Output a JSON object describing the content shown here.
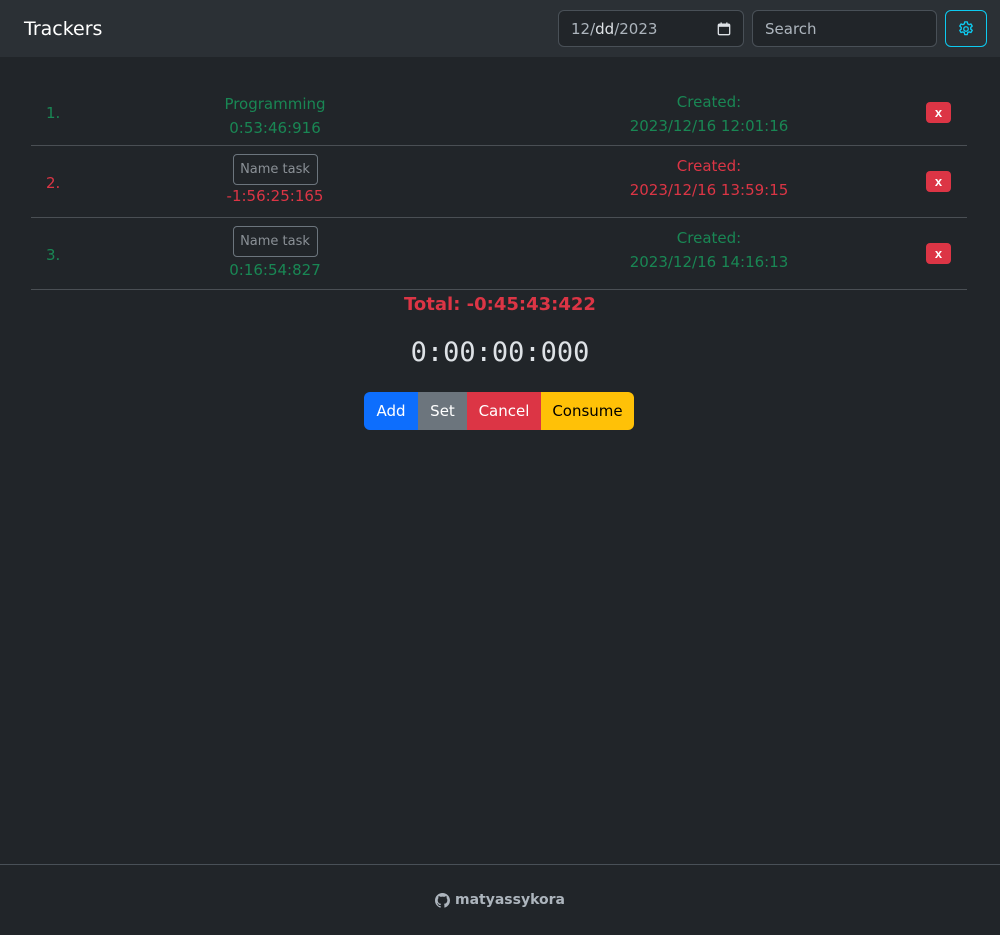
{
  "app": {
    "title": "Trackers"
  },
  "header": {
    "date": {
      "month": "12",
      "sep": "/",
      "day": "dd",
      "year": "2023"
    },
    "search_placeholder": "Search",
    "settings_icon": "gear-icon",
    "accent": "#0dcaf0"
  },
  "trackers": [
    {
      "index": "1.",
      "name": "Programming",
      "elapsed": "0:53:46:916",
      "created_label": "Created:",
      "created": "2023/12/16 12:01:16",
      "status": "positive",
      "delete_label": "x"
    },
    {
      "index": "2.",
      "name_placeholder": "Name task",
      "elapsed": "-1:56:25:165",
      "created_label": "Created:",
      "created": "2023/12/16 13:59:15",
      "status": "negative",
      "delete_label": "x"
    },
    {
      "index": "3.",
      "name_placeholder": "Name task",
      "elapsed": "0:16:54:827",
      "created_label": "Created:",
      "created": "2023/12/16 14:16:13",
      "status": "positive",
      "delete_label": "x"
    }
  ],
  "total": "Total: -0:45:43:422",
  "clock": "0:00:00:000",
  "actions": {
    "add": "Add",
    "set": "Set",
    "cancel": "Cancel",
    "consume": "Consume"
  },
  "footer": {
    "github_user": "matyassykora",
    "icon": "github-icon"
  },
  "colors": {
    "positive": "#198754",
    "negative": "#dc3545",
    "primary": "#0d6efd",
    "secondary": "#6c757d",
    "warning": "#ffc107"
  }
}
